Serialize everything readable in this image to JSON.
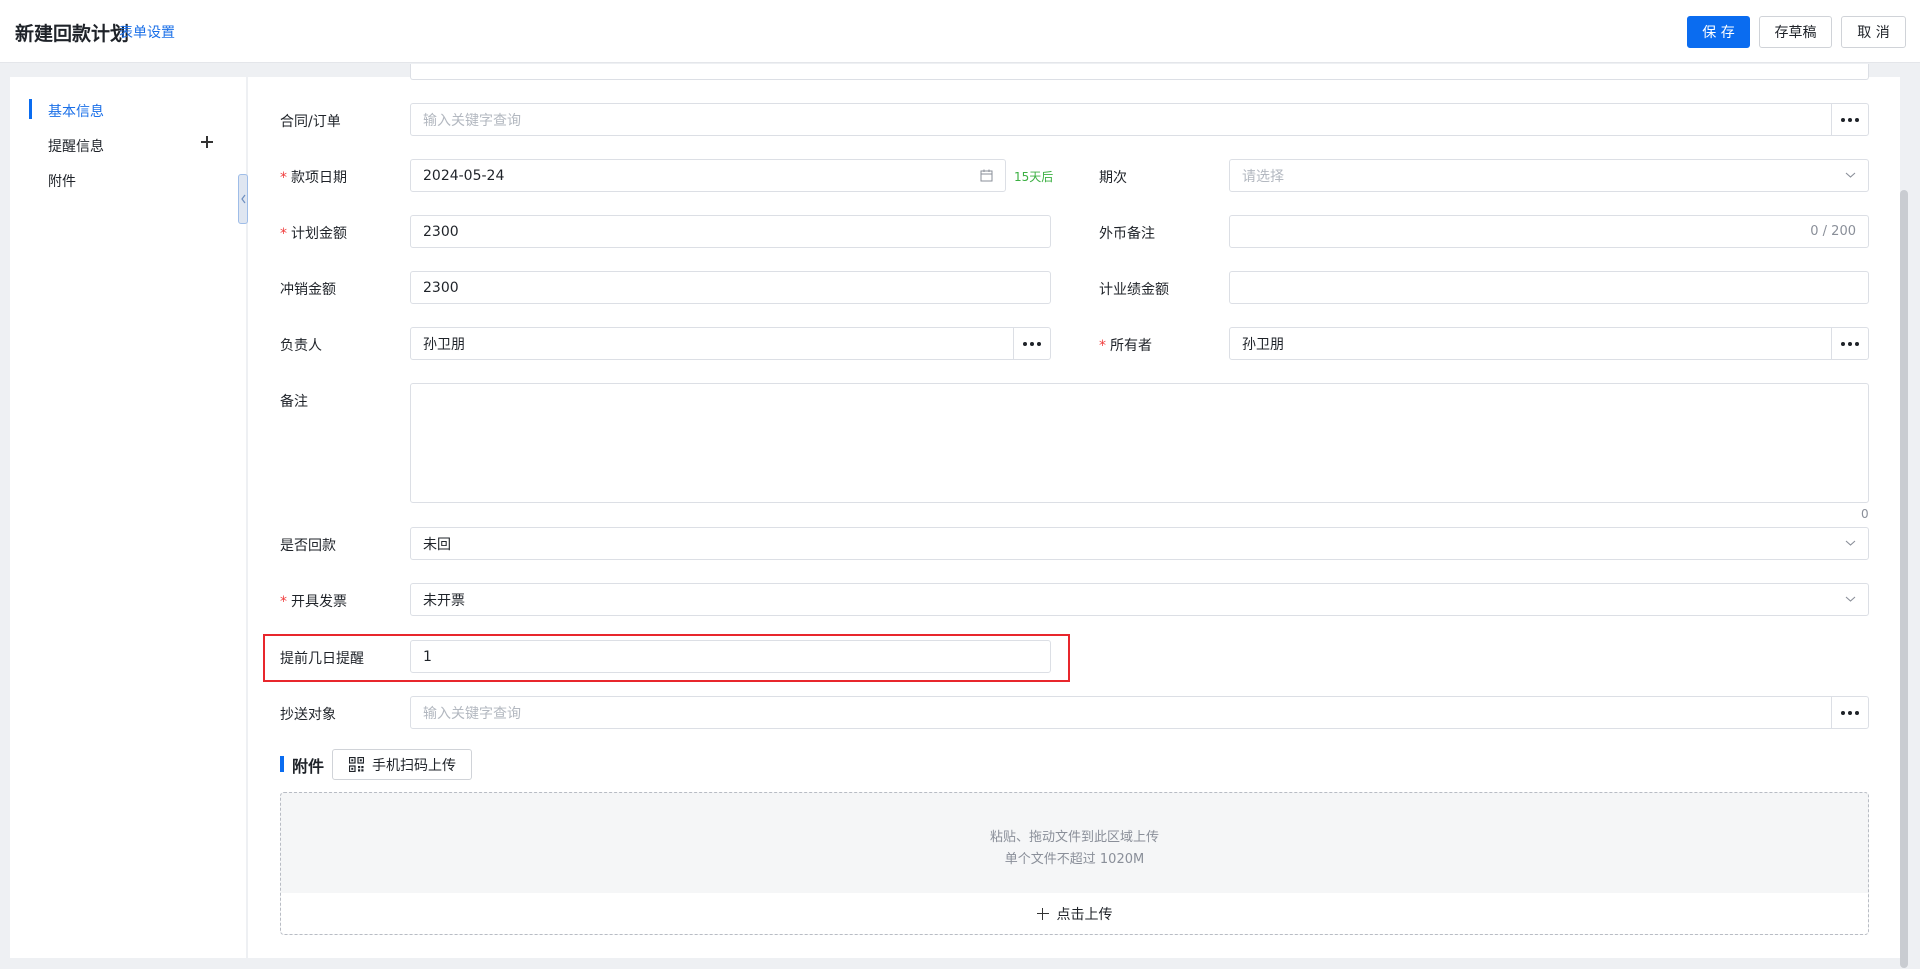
{
  "header": {
    "title": "新建回款计划",
    "form_settings": "表单设置",
    "save_label": "保 存",
    "draft_label": "存草稿",
    "cancel_label": "取 消"
  },
  "sidebar": {
    "items": [
      {
        "label": "基本信息",
        "active": true
      },
      {
        "label": "提醒信息",
        "active": false
      },
      {
        "label": "附件",
        "active": false
      }
    ]
  },
  "form": {
    "contract": {
      "label": "合同/订单",
      "placeholder": "输入关键字查询"
    },
    "due_date": {
      "label": "款项日期",
      "value": "2024-05-24",
      "tag": "15天后",
      "required": true
    },
    "period": {
      "label": "期次",
      "placeholder": "请选择"
    },
    "plan_amount": {
      "label": "计划金额",
      "value": "2300",
      "required": true
    },
    "fx_note": {
      "label": "外币备注",
      "count": "0 / 200"
    },
    "offset_amount": {
      "label": "冲销金额",
      "value": "2300"
    },
    "perf_amount": {
      "label": "计业绩金额",
      "value": ""
    },
    "owner_person": {
      "label": "负责人",
      "value": "孙卫朋"
    },
    "holder": {
      "label": "所有者",
      "value": "孙卫朋",
      "required": true
    },
    "remark": {
      "label": "备注",
      "count": "0"
    },
    "is_paid": {
      "label": "是否回款",
      "value": "未回"
    },
    "invoice": {
      "label": "开具发票",
      "value": "未开票",
      "required": true
    },
    "remind_days": {
      "label": "提前几日提醒",
      "value": "1"
    },
    "cc": {
      "label": "抄送对象",
      "placeholder": "输入关键字查询"
    }
  },
  "attachment": {
    "title": "附件",
    "qr_upload": "手机扫码上传",
    "drop_hint": "粘贴、拖动文件到此区域上传",
    "size_hint": "单个文件不超过 1020M",
    "upload_label": "点击上传"
  }
}
